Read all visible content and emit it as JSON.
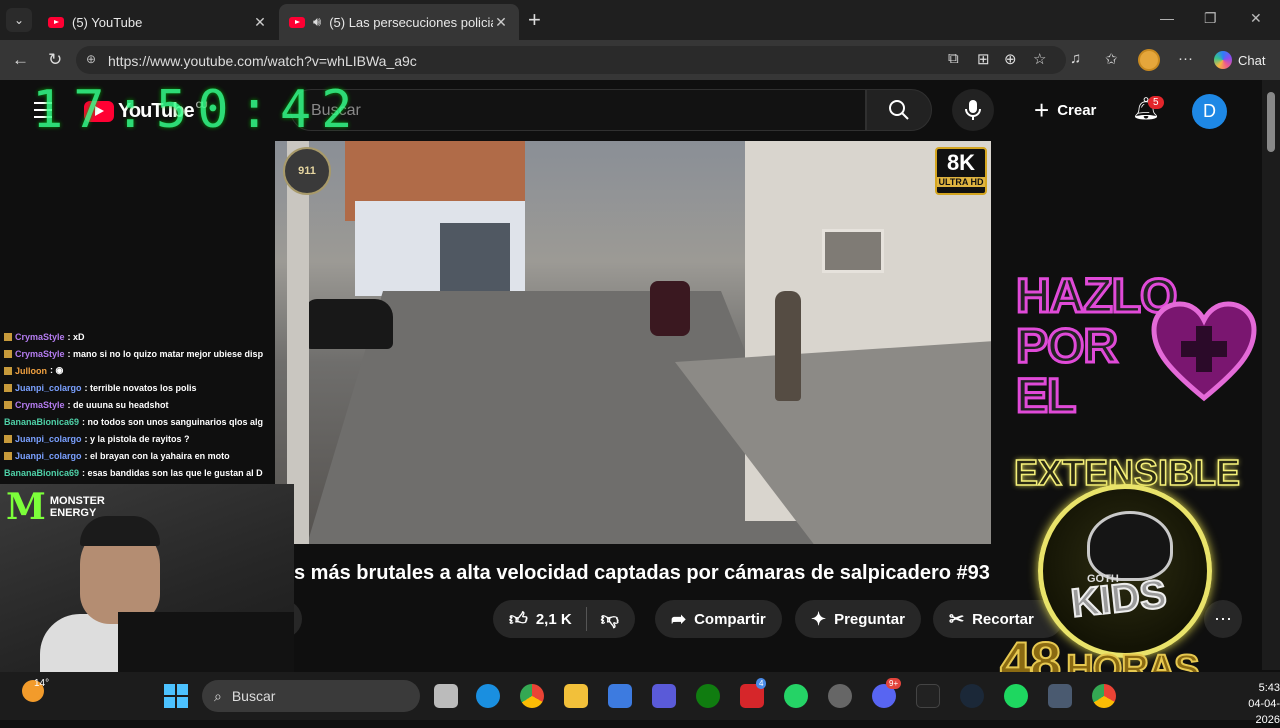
{
  "browser": {
    "tabs": [
      {
        "title": "(5) YouTube"
      },
      {
        "title": "(5) Las persecuciones policiales"
      }
    ],
    "url": "https://www.youtube.com/watch?v=whLIBWa_a9c",
    "chat_label": "Chat"
  },
  "youtube": {
    "logo": "YouTube",
    "country": "CU",
    "search_placeholder": "Buscar",
    "create_label": "Crear",
    "notifications_count": "5",
    "avatar_letter": "D",
    "video_title": "s más brutales a alta velocidad captadas por cámaras de salpicadero #93",
    "likes": "2,1 K",
    "share_label": "Compartir",
    "ask_label": "Preguntar",
    "clip_label": "Recortar",
    "badge_911": "911",
    "badge_8k": "8K",
    "badge_ultra": "ULTRA HD"
  },
  "overlay": {
    "clock": "17:50:42",
    "chat": [
      {
        "user": "CrymaStyle",
        "msg": ": xD",
        "color": "cu1",
        "badge": true
      },
      {
        "user": "CrymaStyle",
        "msg": ": mano si no lo quizo matar mejor ubiese disp",
        "color": "cu1",
        "badge": true
      },
      {
        "user": "Julloon",
        "msg": ": ◉",
        "color": "cu4",
        "badge": true
      },
      {
        "user": "Juanpi_colargo",
        "msg": ": terrible novatos los polis",
        "color": "cu2",
        "badge": true
      },
      {
        "user": "CrymaStyle",
        "msg": ": de uuuna su headshot",
        "color": "cu1",
        "badge": true
      },
      {
        "user": "BananaBionica69",
        "msg": ": no todos son unos sanguinarios qlos alg",
        "color": "cu3",
        "badge": false
      },
      {
        "user": "Juanpi_colargo",
        "msg": ": y la pistola de rayitos ?",
        "color": "cu2",
        "badge": true
      },
      {
        "user": "Juanpi_colargo",
        "msg": ": el brayan con la yahaira en moto",
        "color": "cu2",
        "badge": true
      },
      {
        "user": "BananaBionica69",
        "msg": ": esas bandidas son las que le gustan al D",
        "color": "cu3",
        "badge": false
      }
    ],
    "monster_m": "M",
    "monster_text": "MONSTER ENERGY",
    "hazlo": [
      "HAZLO",
      "POR",
      "EL"
    ],
    "extensible": "EXTENSIBLE",
    "goth": "GOTH",
    "kids": "KIDS",
    "hours_num": "48",
    "hours_word": "HORAS"
  },
  "taskbar": {
    "temperature": "14°",
    "search_label": "Buscar",
    "time": "5:43",
    "date": "04-04-2026",
    "edge_badge": "4",
    "discord_badge": "9+"
  }
}
